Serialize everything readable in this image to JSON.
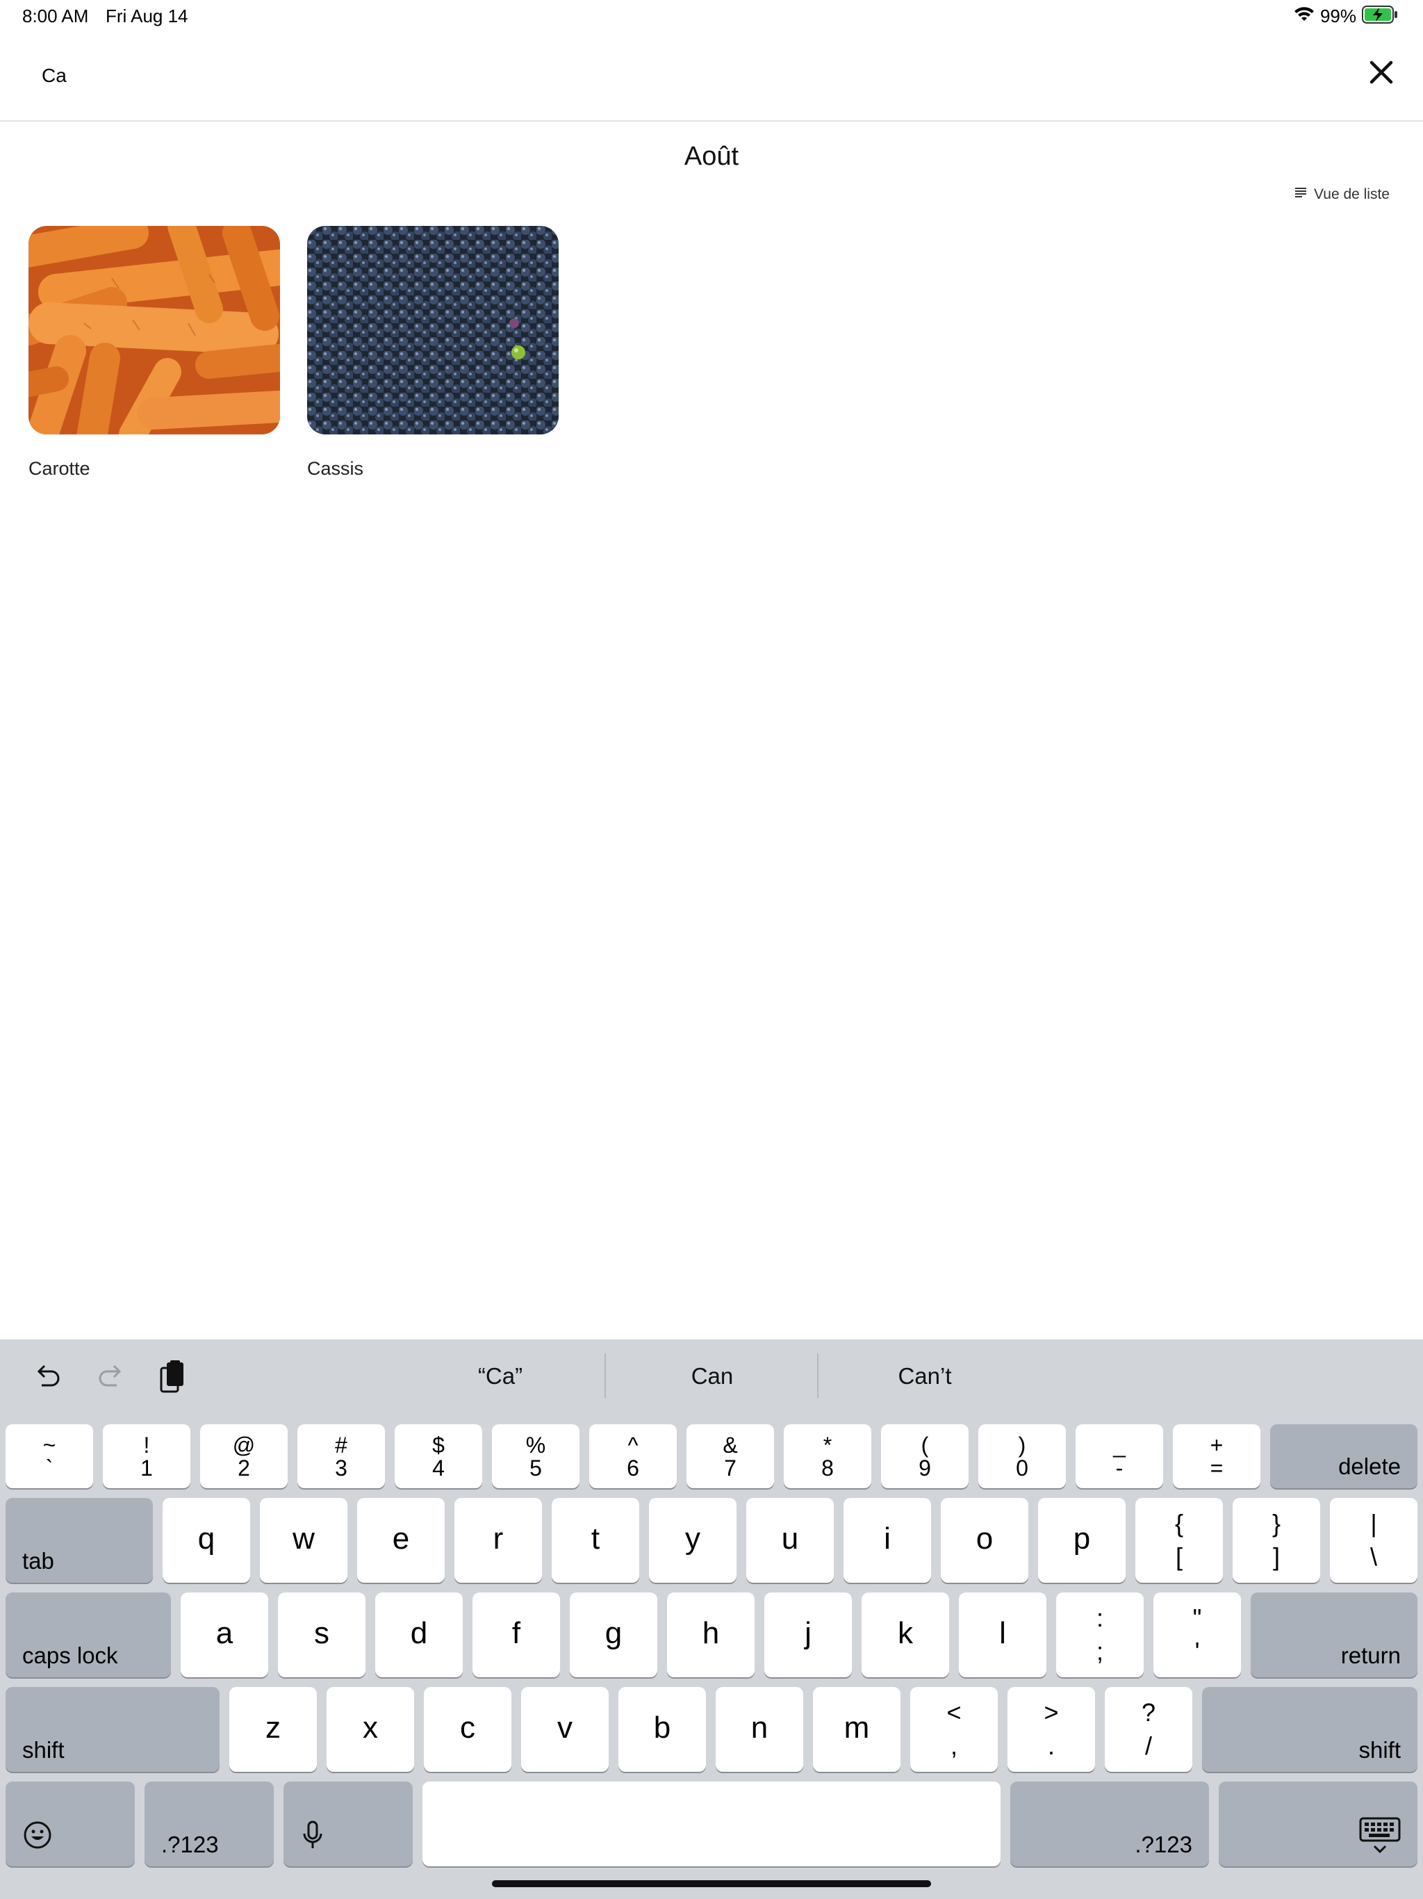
{
  "status_bar": {
    "time": "8:00 AM",
    "date": "Fri Aug 14",
    "battery_percent": "99%"
  },
  "search": {
    "value": "Ca"
  },
  "content": {
    "month_title": "Août",
    "list_view_label": "Vue de liste",
    "results": [
      {
        "name": "Carotte",
        "image": "carrots-photo"
      },
      {
        "name": "Cassis",
        "image": "blackcurrants-photo"
      }
    ]
  },
  "keyboard": {
    "suggestions": [
      "“Ca”",
      "Can",
      "Can’t"
    ],
    "number_row": [
      {
        "top": "~",
        "bottom": "`"
      },
      {
        "top": "!",
        "bottom": "1"
      },
      {
        "top": "@",
        "bottom": "2"
      },
      {
        "top": "#",
        "bottom": "3"
      },
      {
        "top": "$",
        "bottom": "4"
      },
      {
        "top": "%",
        "bottom": "5"
      },
      {
        "top": "^",
        "bottom": "6"
      },
      {
        "top": "&",
        "bottom": "7"
      },
      {
        "top": "*",
        "bottom": "8"
      },
      {
        "top": "(",
        "bottom": "9"
      },
      {
        "top": ")",
        "bottom": "0"
      },
      {
        "top": "_",
        "bottom": "-"
      },
      {
        "top": "+",
        "bottom": "="
      }
    ],
    "delete_label": "delete",
    "tab_label": "tab",
    "row_q": [
      "q",
      "w",
      "e",
      "r",
      "t",
      "y",
      "u",
      "i",
      "o",
      "p"
    ],
    "row_q_symbols": [
      {
        "top": "{",
        "bottom": "["
      },
      {
        "top": "}",
        "bottom": "]"
      },
      {
        "top": "|",
        "bottom": "\\"
      }
    ],
    "caps_lock_label": "caps lock",
    "row_a": [
      "a",
      "s",
      "d",
      "f",
      "g",
      "h",
      "j",
      "k",
      "l"
    ],
    "row_a_symbols": [
      {
        "top": ":",
        "bottom": ";"
      },
      {
        "top": "\"",
        "bottom": "'"
      }
    ],
    "return_label": "return",
    "shift_label": "shift",
    "row_z": [
      "z",
      "x",
      "c",
      "v",
      "b",
      "n",
      "m"
    ],
    "row_z_symbols": [
      {
        "top": "<",
        "bottom": ","
      },
      {
        "top": ">",
        "bottom": "."
      },
      {
        "top": "?",
        "bottom": "/"
      }
    ],
    "numbers_label": ".?123"
  }
}
